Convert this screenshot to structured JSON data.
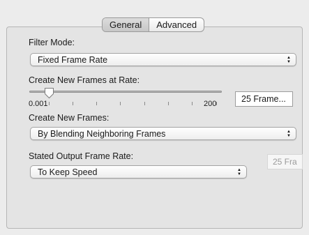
{
  "tabs": {
    "general": "General",
    "advanced": "Advanced",
    "selected": "General"
  },
  "filter_mode": {
    "label": "Filter Mode:",
    "value": "Fixed Frame Rate"
  },
  "frame_rate": {
    "label": "Create New Frames at Rate:",
    "slider_min": "0.001",
    "slider_max": "200",
    "field_value": "25 Frame..."
  },
  "new_frames": {
    "label": "Create New Frames:",
    "value": "By Blending Neighboring Frames"
  },
  "output_rate": {
    "label": "Stated Output Frame Rate:",
    "value": "To Keep Speed",
    "field_value": "25 Fra"
  }
}
